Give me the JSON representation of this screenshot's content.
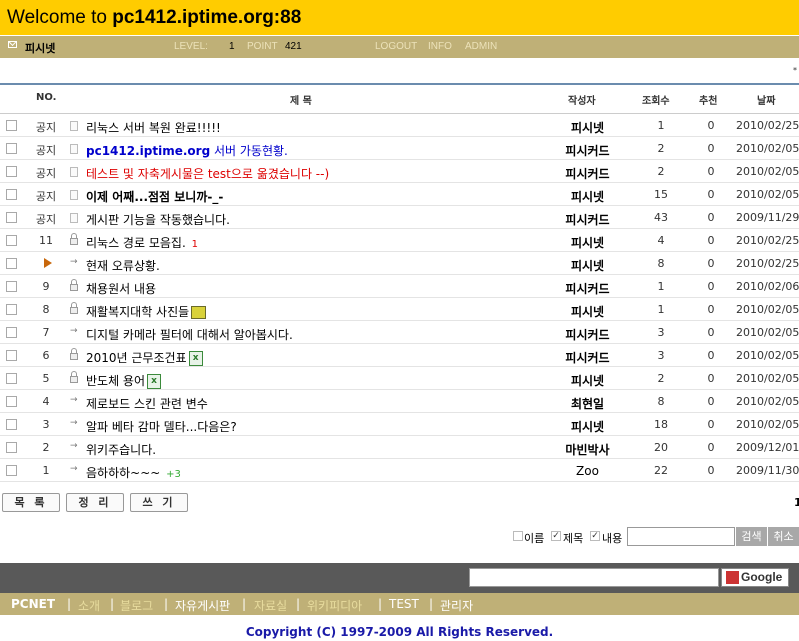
{
  "header": {
    "title_prefix": "Welcome to ",
    "title_host": "pc1412.iptime.org:88"
  },
  "userbar": {
    "nick": "피시넷",
    "level_label": "LEVEL:",
    "level_value": "1",
    "point_label": "POINT",
    "point_value": "421",
    "logout": "LOGOUT",
    "info": "INFO",
    "admin": "ADMIN"
  },
  "star": "*",
  "columns": {
    "no": "NO.",
    "subject": "제 목",
    "author": "작성자",
    "hits": "조회수",
    "recommend": "추천",
    "date": "날짜"
  },
  "rows": [
    {
      "no": "공지",
      "subject": "리눅스 서버 복원 완료!!!!!",
      "author": "피시넷",
      "hits": "1",
      "rec": "0",
      "date": "2010/02/25"
    },
    {
      "no": "공지",
      "subject_a": "pc1412.iptime.org",
      "subject_b": " 서버 가동현황.",
      "author": "피시커드",
      "hits": "2",
      "rec": "0",
      "date": "2010/02/05"
    },
    {
      "no": "공지",
      "subject": "테스트 및 자축게시물은 test으로 옮겼습니다 --)",
      "author": "피시커드",
      "hits": "2",
      "rec": "0",
      "date": "2010/02/05"
    },
    {
      "no": "공지",
      "subject": "이제 어째...점점 보니까-_-",
      "author": "피시넷",
      "hits": "15",
      "rec": "0",
      "date": "2010/02/05"
    },
    {
      "no": "공지",
      "subject": "게시판 기능을 작동했습니다.",
      "author": "피시커드",
      "hits": "43",
      "rec": "0",
      "date": "2009/11/29"
    },
    {
      "no": "11",
      "subject": "리눅스 경로 모음집.",
      "comments": "1",
      "author": "피시넷",
      "hits": "4",
      "rec": "0",
      "date": "2010/02/25"
    },
    {
      "no": "",
      "subject": "현재 오류상황.",
      "author": "피시넷",
      "hits": "8",
      "rec": "0",
      "date": "2010/02/25"
    },
    {
      "no": "9",
      "subject": "채용원서 내용",
      "author": "피시커드",
      "hits": "1",
      "rec": "0",
      "date": "2010/02/06"
    },
    {
      "no": "8",
      "subject": "재활복지대학 사진들",
      "author": "피시넷",
      "hits": "1",
      "rec": "0",
      "date": "2010/02/05"
    },
    {
      "no": "7",
      "subject": "디지털 카메라 필터에 대해서 알아봅시다.",
      "author": "피시커드",
      "hits": "3",
      "rec": "0",
      "date": "2010/02/05"
    },
    {
      "no": "6",
      "subject": "2010년 근무조건표",
      "author": "피시커드",
      "hits": "3",
      "rec": "0",
      "date": "2010/02/05"
    },
    {
      "no": "5",
      "subject": "반도체 용어",
      "author": "피시넷",
      "hits": "2",
      "rec": "0",
      "date": "2010/02/05"
    },
    {
      "no": "4",
      "subject": "제로보드 스킨 관련 변수",
      "author": "최현일",
      "hits": "8",
      "rec": "0",
      "date": "2010/02/05"
    },
    {
      "no": "3",
      "subject": "알파 베타 감마 델타...다음은?",
      "author": "피시넷",
      "hits": "18",
      "rec": "0",
      "date": "2010/02/05"
    },
    {
      "no": "2",
      "subject": "위키주습니다.",
      "author": "마빈박사",
      "hits": "20",
      "rec": "0",
      "date": "2009/12/01"
    },
    {
      "no": "1",
      "subject": "음하하하~~~",
      "comments": "+3",
      "author": "Zoo",
      "hits": "22",
      "rec": "0",
      "date": "2009/11/30"
    }
  ],
  "buttons": {
    "list": "목 록",
    "sort": "정 리",
    "write": "쓰 기"
  },
  "page_number": "1",
  "search": {
    "name_label": "이름",
    "subject_label": "제목",
    "content_label": "내용",
    "name_checked": false,
    "subject_checked": true,
    "content_checked": true,
    "search_btn": "검색",
    "cancel_btn": "취소"
  },
  "google_label": "Google",
  "nav": {
    "brand": "PCNET",
    "items": [
      "소개",
      "블로그",
      "자유게시판",
      "자료실",
      "위키피디아",
      "TEST",
      "관리자"
    ],
    "sep": "|"
  },
  "copyright": "Copyright (C) 1997-2009 All Rights Reserved."
}
